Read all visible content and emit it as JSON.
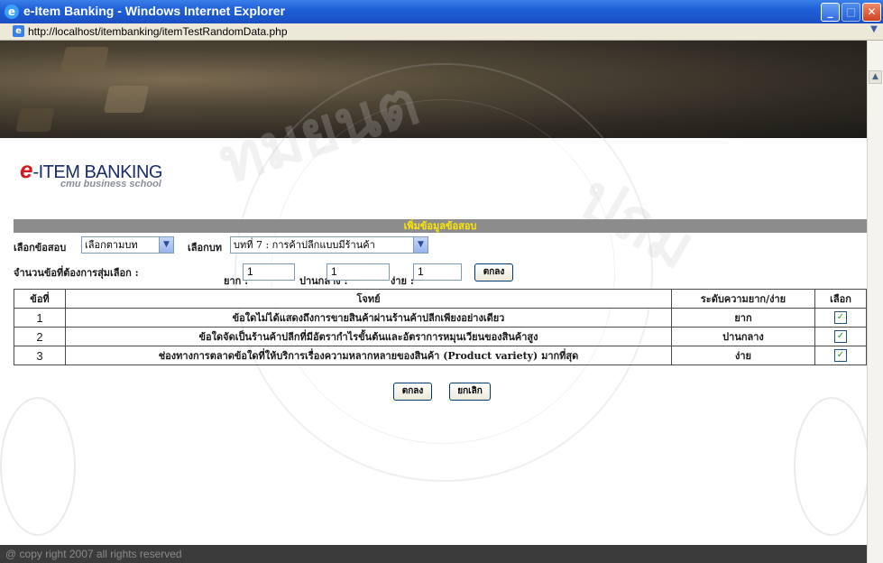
{
  "window": {
    "title": "e-Item Banking - Windows Internet Explorer",
    "address": "http://localhost/itembanking/itemTestRandomData.php"
  },
  "logo": {
    "e": "e",
    "name": "-ITEM BANKING",
    "sub": "cmu business school"
  },
  "form": {
    "title": "เพิ่มข้อมูลข้อสอบ",
    "select_exam_label": "เลือกข้อสอบ",
    "select_exam_value": "เลือกตามบท",
    "select_chapter_label": "เลือกบท",
    "select_chapter_value": "บทที่ 7 : การค้าปลีกแบบมีร้านค้า",
    "count_label": "จำนวนข้อที่ต้องการสุ่มเลือก :",
    "hard_label": "ยาก :",
    "hard_value": "1",
    "medium_label": "ปานกลาง :",
    "medium_value": "1",
    "easy_label": "ง่าย :",
    "easy_value": "1",
    "ok_label": "ตกลง"
  },
  "table": {
    "headers": [
      "ข้อที่",
      "โจทย์",
      "ระดับความยาก/ง่าย",
      "เลือก"
    ],
    "rows": [
      {
        "num": "1",
        "question": "ข้อใดไม่ได้แสดงถึงการขายสินค้าผ่านร้านค้าปลีกเพียงอย่างเดียว",
        "level": "ยาก",
        "checked": "✓"
      },
      {
        "num": "2",
        "question": "ข้อใดจัดเป็นร้านค้าปลีกที่มีอัตรากำไรขั้นต้นและอัตราการหมุนเวียนของสินค้าสูง",
        "level": "ปานกลาง",
        "checked": "✓"
      },
      {
        "num": "3",
        "question": "ช่องทางการตลาดข้อใดที่ให้บริการเรื่องความหลากหลายของสินค้า (Product variety) มากที่สุด",
        "level": "ง่าย",
        "checked": "✓"
      }
    ]
  },
  "actions": {
    "ok_label": "ตกลง",
    "cancel_label": "ยกเลิก"
  },
  "footer": {
    "copyright": "@ copy right 2007 all rights reserved"
  },
  "watermark": {
    "text1": "ทมยนต",
    "text2": "ปถม"
  }
}
